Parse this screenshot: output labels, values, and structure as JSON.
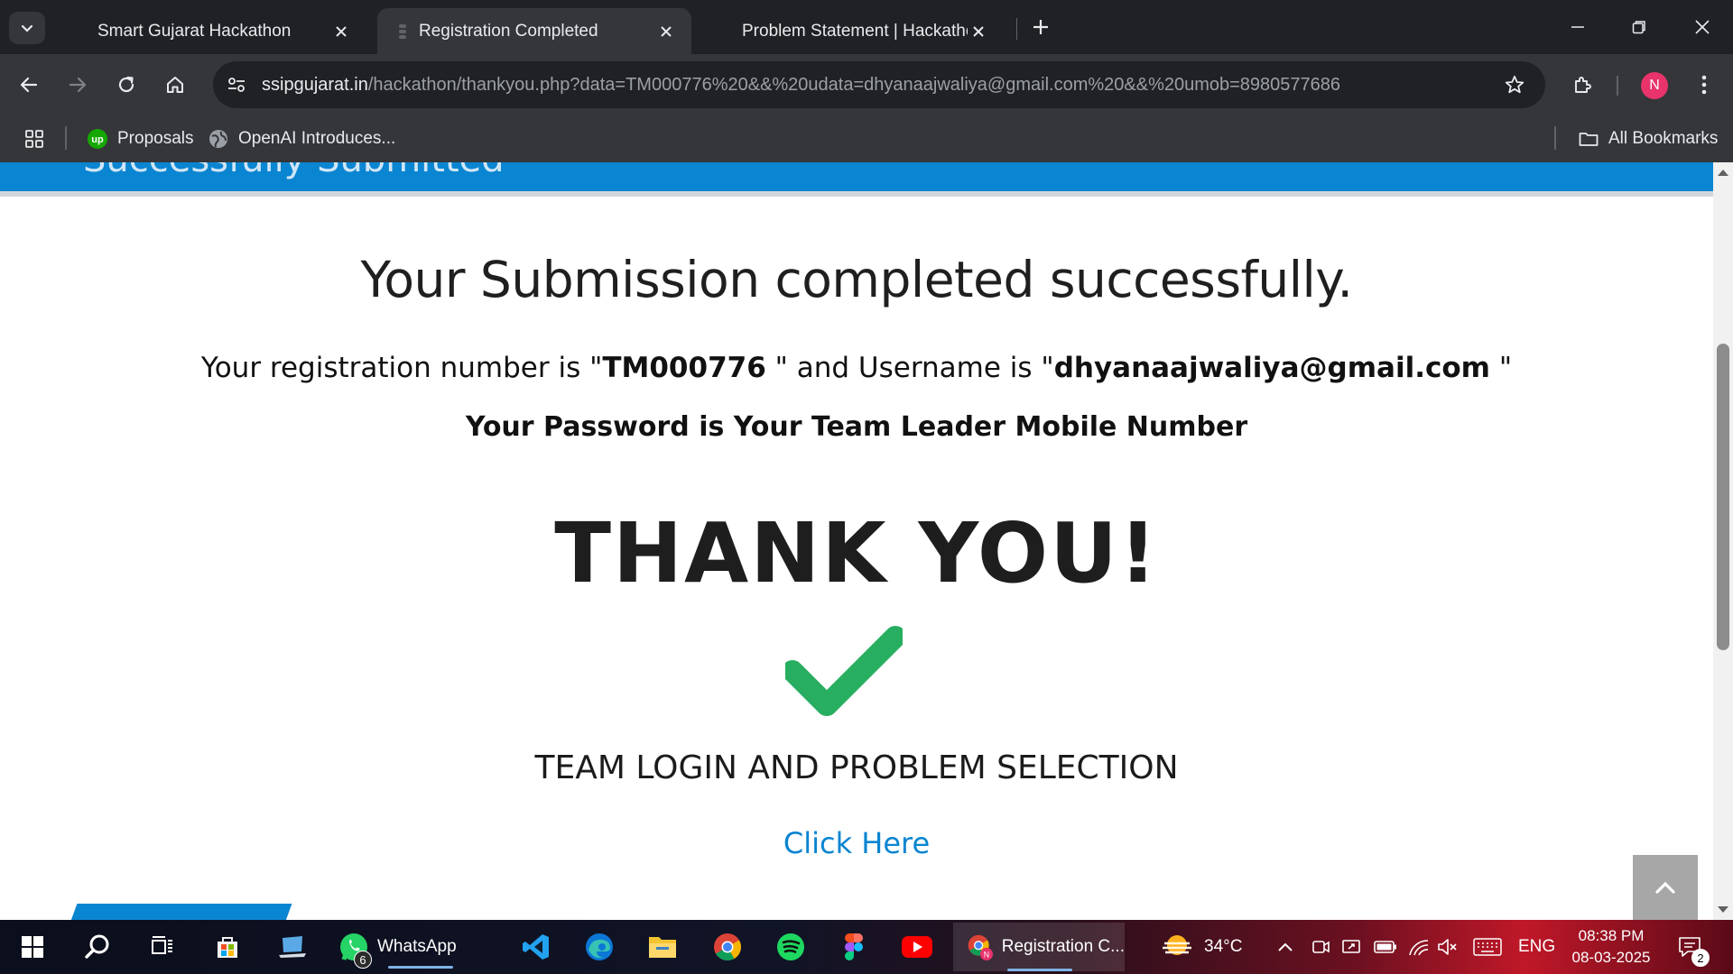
{
  "tabs": [
    {
      "title": "Smart Gujarat Hackathon",
      "active": false
    },
    {
      "title": "Registration Completed",
      "active": true
    },
    {
      "title": "Problem Statement | Hackathon",
      "active": false
    }
  ],
  "toolbar": {
    "url_host": "ssipgujarat.in",
    "url_path": "/hackathon/thankyou.php?data=TM000776%20&&%20udata=dhyanaajwaliya@gmail.com%20&&%20umob=8980577686",
    "profile_initial": "N"
  },
  "bookmarks": {
    "items": [
      {
        "label": "Proposals",
        "icon": "upwork-icon"
      },
      {
        "label": "OpenAI Introduces...",
        "icon": "globe-icon"
      }
    ],
    "all_label": "All Bookmarks"
  },
  "page": {
    "band_ghost_text": "Successfully Submitted",
    "headline": "Your Submission completed successfully.",
    "reg_prefix": "Your registration number is \"",
    "reg_number": "TM000776",
    "reg_middle": " \" and Username is \"",
    "username": "dhyanaajwaliya@gmail.com",
    "reg_suffix": " \"",
    "password_note": "Your Password is Your Team Leader Mobile Number",
    "thank_you": "THANK YOU!",
    "team_login": "TEAM LOGIN AND PROBLEM SELECTION",
    "click_here": "Click Here"
  },
  "taskbar": {
    "whatsapp_label": "WhatsApp",
    "whatsapp_badge": "6",
    "chrome_window_label": "Registration C...",
    "weather": "34°C",
    "language": "ENG",
    "time": "08:38 PM",
    "date": "08-03-2025",
    "notification_count": "2"
  },
  "colors": {
    "accent_blue": "#0a85d1",
    "check_green": "#27ae60",
    "chrome_dark": "#202124",
    "chrome_toolbar": "#35363a"
  }
}
